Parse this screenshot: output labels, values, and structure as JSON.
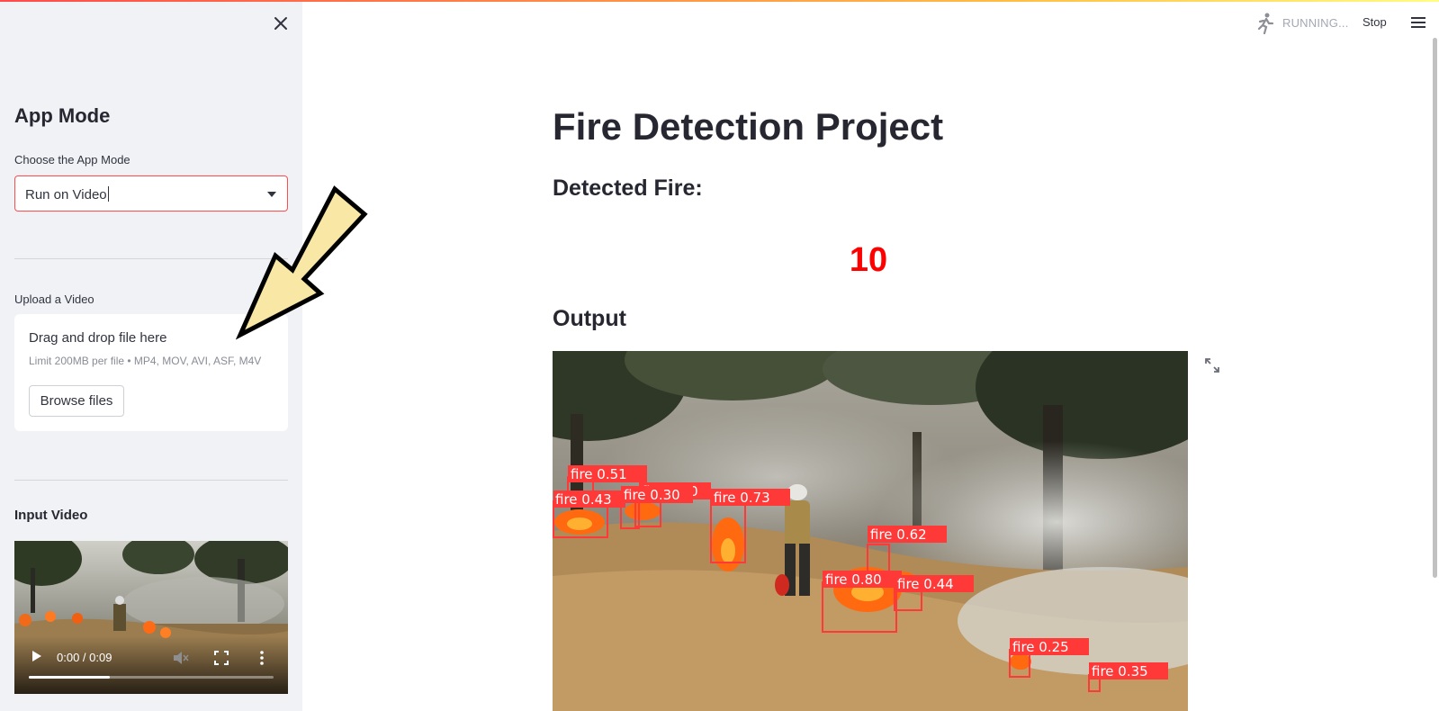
{
  "sidebar": {
    "title": "App Mode",
    "mode_label": "Choose the App Mode",
    "mode_value": "Run on Video",
    "upload_label": "Upload a Video",
    "uploader": {
      "title": "Drag and drop file here",
      "subtitle": "Limit 200MB per file • MP4, MOV, AVI, ASF, M4V",
      "button": "Browse files"
    },
    "input_video_label": "Input Video",
    "video": {
      "time": "0:00 / 0:09",
      "progress": 0.33
    }
  },
  "header": {
    "status": "RUNNING...",
    "stop_label": "Stop"
  },
  "main": {
    "title": "Fire Detection Project",
    "detected_label": "Detected Fire:",
    "detected_count": "10",
    "output_label": "Output",
    "detections": [
      {
        "label": "fire",
        "score": "0.51"
      },
      {
        "label": "fire",
        "score": "0.43"
      },
      {
        "label": "fire",
        "score": "0.30"
      },
      {
        "label": "fire",
        "score": "0.30"
      },
      {
        "label": "fire",
        "score": "0.73"
      },
      {
        "label": "fire",
        "score": "0.62"
      },
      {
        "label": "fire",
        "score": "0.80"
      },
      {
        "label": "fire",
        "score": "0.44"
      },
      {
        "label": "fire",
        "score": "0.25"
      },
      {
        "label": "fire",
        "score": "0.35"
      }
    ]
  },
  "colors": {
    "accent": "#ff4b4b",
    "count": "#ff0000",
    "box": "#ff3838",
    "sidebar_bg": "#f0f2f6"
  },
  "icons": [
    "close-icon",
    "dropdown-arrow-icon",
    "running-man-icon",
    "hamburger-menu-icon",
    "expand-icon",
    "play-icon",
    "volume-icon",
    "fullscreen-icon",
    "more-vert-icon"
  ]
}
